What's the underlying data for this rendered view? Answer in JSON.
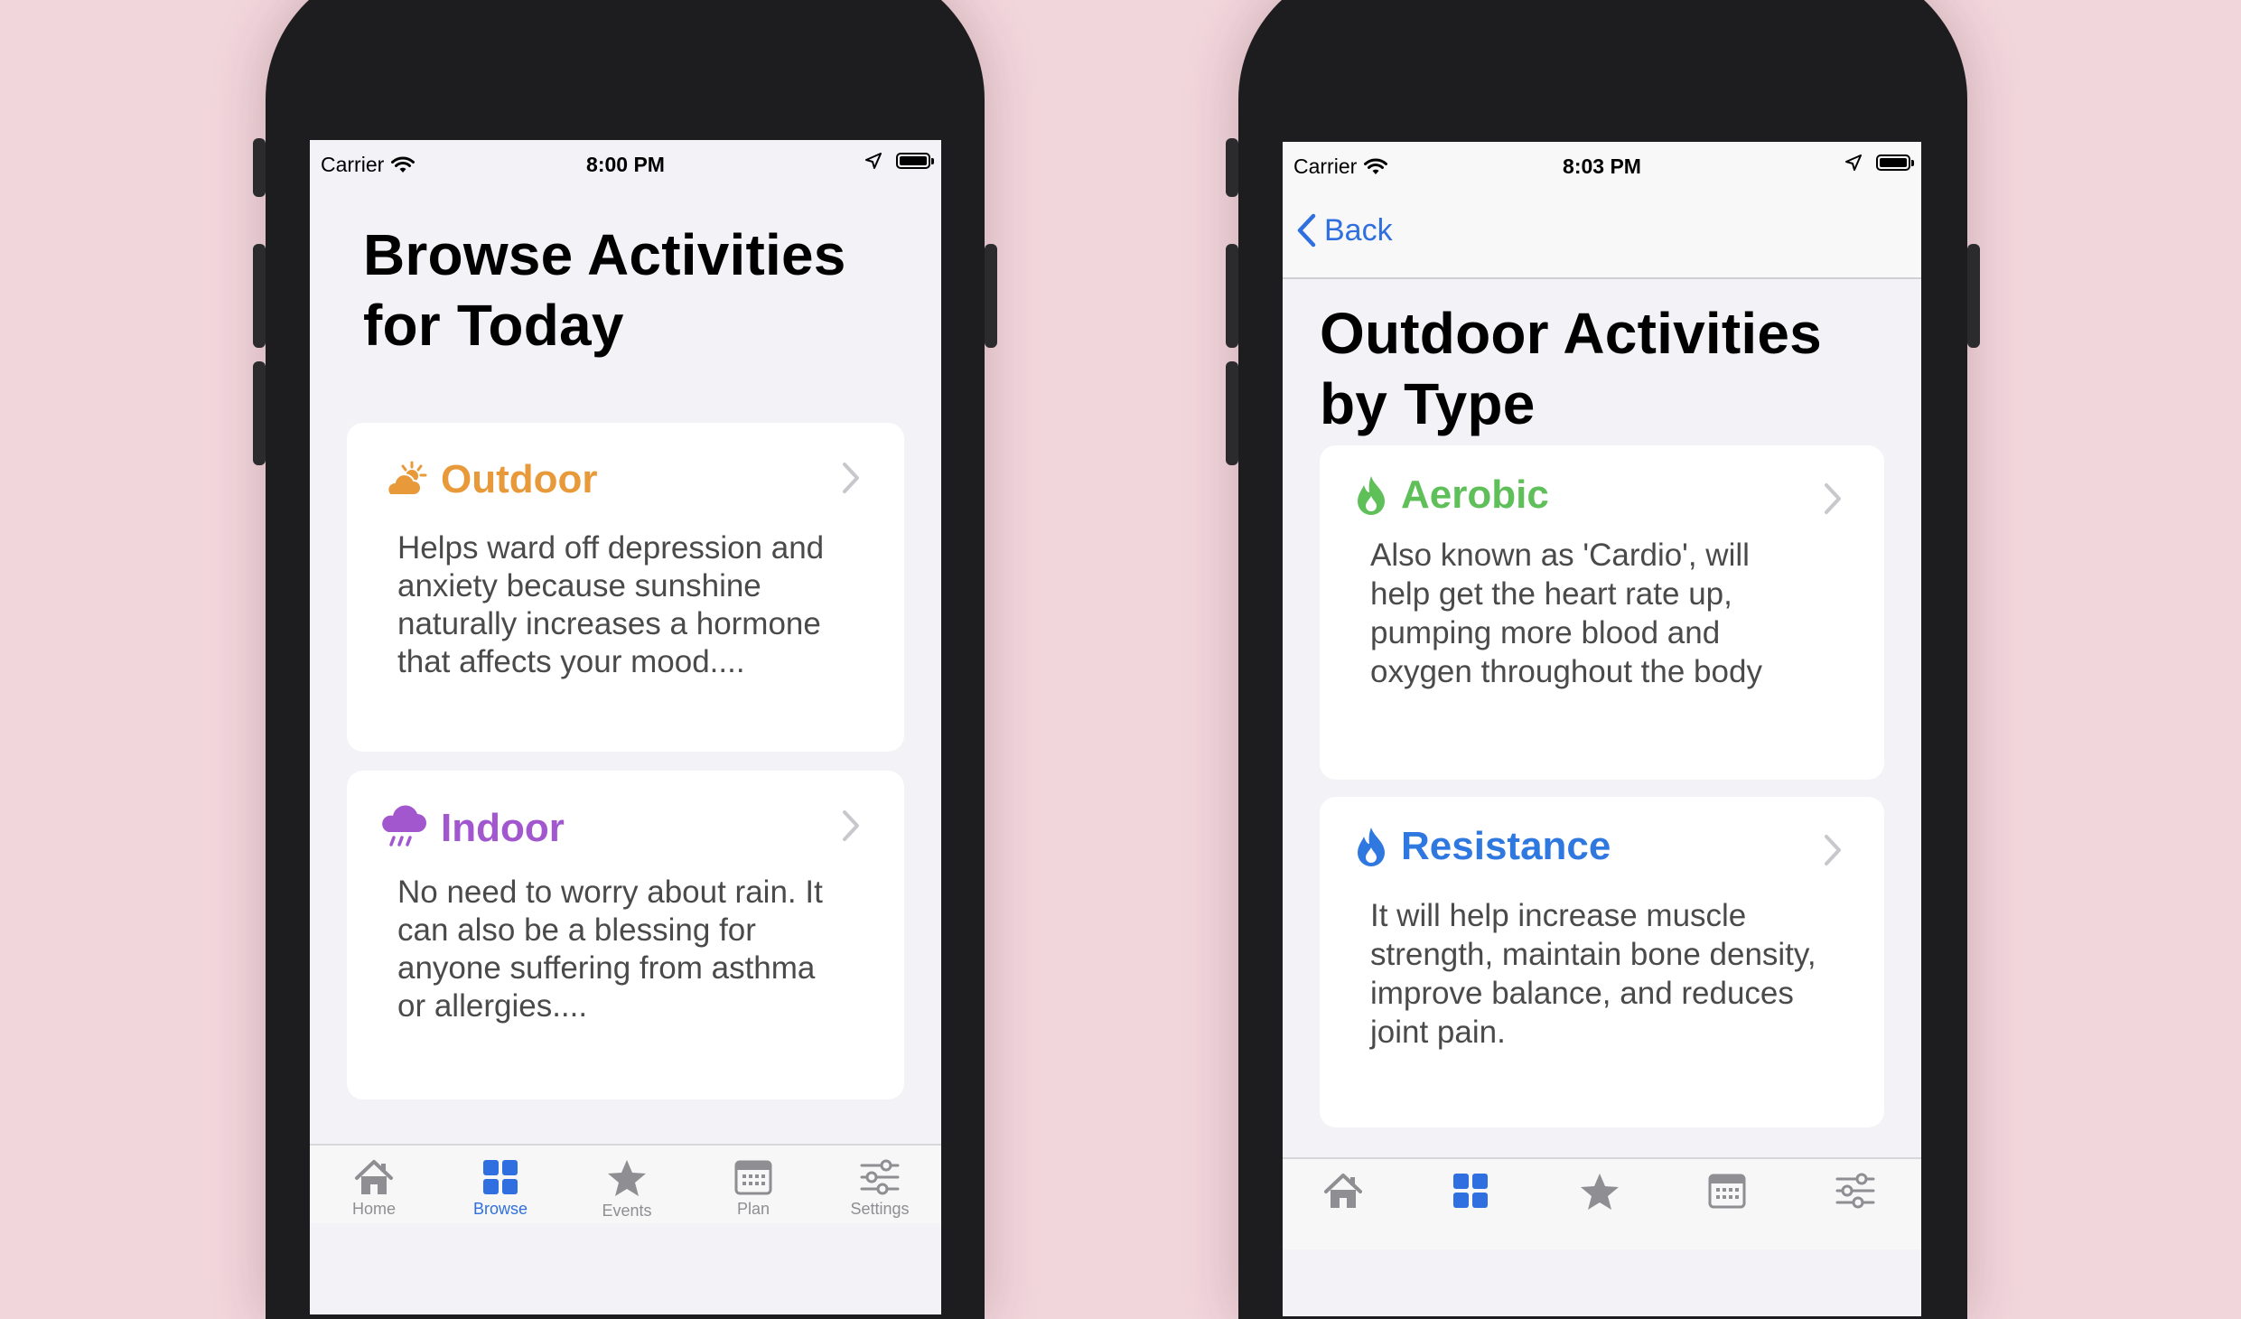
{
  "left": {
    "status": {
      "carrier": "Carrier",
      "time": "8:00 PM"
    },
    "title_line1": "Browse Activities",
    "title_line2": "for Today",
    "cards": [
      {
        "title": "Outdoor",
        "icon": "sun-cloud-icon",
        "color": "#e8993a",
        "description": "Helps ward off depression and anxiety because sunshine naturally increases a hormone that affects your mood...."
      },
      {
        "title": "Indoor",
        "icon": "rain-cloud-icon",
        "color": "#a257cf",
        "description": "No need to worry about rain. It can also be a blessing for anyone suffering from asthma or allergies...."
      }
    ],
    "tabs": [
      "Home",
      "Browse",
      "Events",
      "Plan",
      "Settings"
    ],
    "active_tab": "Browse"
  },
  "right": {
    "status": {
      "carrier": "Carrier",
      "time": "8:03 PM"
    },
    "back_label": "Back",
    "title_line1": "Outdoor Activities",
    "title_line2": "by Type",
    "cards": [
      {
        "title": "Aerobic",
        "icon": "flame-icon",
        "color": "#5fbf59",
        "description": "Also known as 'Cardio', will help get the heart rate up, pumping more blood and oxygen throughout the body"
      },
      {
        "title": "Resistance",
        "icon": "flame-icon",
        "color": "#2f78e0",
        "description": "It will help increase muscle strength, maintain bone density, improve balance, and reduces joint pain."
      }
    ]
  },
  "colors": {
    "accent": "#2f6fe0",
    "background": "#f1d6dc",
    "inactive_tab": "#8e8e93"
  }
}
